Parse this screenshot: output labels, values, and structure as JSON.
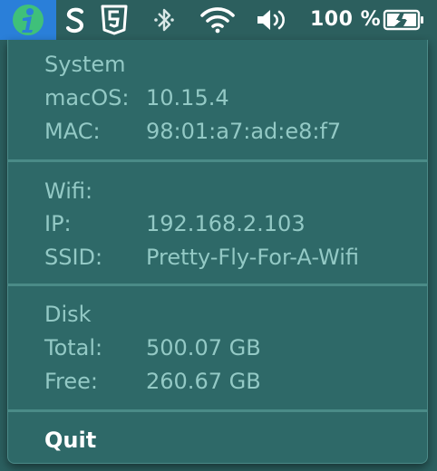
{
  "menubar": {
    "icons": [
      "info-app-icon",
      "skype-icon",
      "html5-shield-icon",
      "bluetooth-icon",
      "wifi-icon",
      "volume-icon",
      "battery-charging-icon"
    ],
    "battery_text": "100 %",
    "accent": "#2a7fd9"
  },
  "menu": {
    "system": {
      "heading": "System",
      "macos_label": "macOS:",
      "macos_value": "10.15.4",
      "mac_label": "MAC:",
      "mac_value": "98:01:a7:ad:e8:f7"
    },
    "wifi": {
      "heading": "Wifi:",
      "ip_label": "IP:",
      "ip_value": "192.168.2.103",
      "ssid_label": "SSID:",
      "ssid_value": "Pretty-Fly-For-A-Wifi"
    },
    "disk": {
      "heading": "Disk",
      "total_label": "Total:",
      "total_value": "500.07 GB",
      "free_label": "Free:",
      "free_value": "260.67 GB"
    },
    "quit_label": "Quit"
  }
}
